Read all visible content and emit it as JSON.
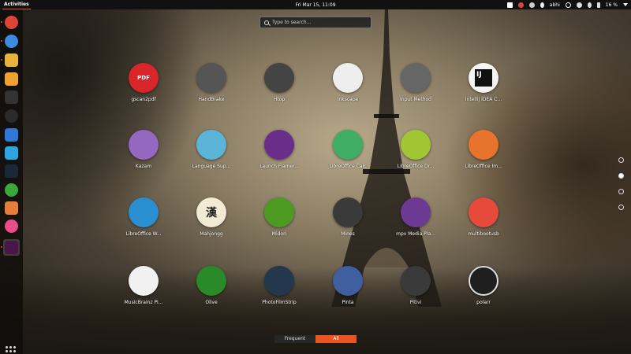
{
  "topbar": {
    "activities": "Activities",
    "clock": "Fri Mar 15, 11:09",
    "user": "abhi",
    "battery": "16 %"
  },
  "search": {
    "placeholder": "Type to search..."
  },
  "dock": {
    "items": [
      {
        "name": "chrome",
        "glyph": "",
        "color": "#db4437"
      },
      {
        "name": "firefox",
        "glyph": "",
        "color": "#3d8be0"
      },
      {
        "name": "files",
        "glyph": "",
        "color": "#e8b23a"
      },
      {
        "name": "ubuntu-software",
        "glyph": "",
        "color": "#f0a030"
      },
      {
        "name": "terminal",
        "glyph": "",
        "color": "#333333"
      },
      {
        "name": "obs",
        "glyph": "",
        "color": "#2b2b2b"
      },
      {
        "name": "virtualbox",
        "glyph": "",
        "color": "#2f78d6"
      },
      {
        "name": "telegram",
        "glyph": "",
        "color": "#2ca5e0"
      },
      {
        "name": "steam",
        "glyph": "",
        "color": "#1b2838"
      },
      {
        "name": "update",
        "glyph": "",
        "color": "#3aa83a"
      },
      {
        "name": "calculator",
        "glyph": "",
        "color": "#e67d3a"
      },
      {
        "name": "headset",
        "glyph": "",
        "color": "#e84c8a"
      },
      {
        "name": "slack",
        "glyph": "",
        "color": "#4a154b"
      }
    ]
  },
  "apps": [
    {
      "label": "gscan2pdf",
      "glyph": "PDF",
      "color": "#d9262a"
    },
    {
      "label": "HandBrake",
      "glyph": "",
      "color": "#555555"
    },
    {
      "label": "Htop",
      "glyph": "",
      "color": "#444444"
    },
    {
      "label": "Inkscape",
      "glyph": "",
      "color": "#eeeeee"
    },
    {
      "label": "Input Method",
      "glyph": "",
      "color": "#666666"
    },
    {
      "label": "IntelliJ IDEA C...",
      "glyph": "IJ",
      "color": "#f4f4f4"
    },
    {
      "label": "Kazam",
      "glyph": "",
      "color": "#9467c0"
    },
    {
      "label": "Language Sup...",
      "glyph": "",
      "color": "#5ab5d9"
    },
    {
      "label": "Launch Flamer...",
      "glyph": "",
      "color": "#6a2d8a"
    },
    {
      "label": "LibreOffice Calc",
      "glyph": "",
      "color": "#3fae64"
    },
    {
      "label": "LibreOffice Dr...",
      "glyph": "",
      "color": "#a0c633"
    },
    {
      "label": "LibreOffice Im...",
      "glyph": "",
      "color": "#e8732c"
    },
    {
      "label": "LibreOffice W...",
      "glyph": "",
      "color": "#2a8fd1"
    },
    {
      "label": "Mahjongg",
      "glyph": "漢",
      "color": "#f2ead3"
    },
    {
      "label": "Midori",
      "glyph": "",
      "color": "#4c9a22"
    },
    {
      "label": "Mines",
      "glyph": "",
      "color": "#3a3a3a"
    },
    {
      "label": "mpv Media Pla...",
      "glyph": "",
      "color": "#6c3a93"
    },
    {
      "label": "multibootusb",
      "glyph": "",
      "color": "#e64a3b"
    },
    {
      "label": "MusicBrainz Pi...",
      "glyph": "",
      "color": "#f1f1f1"
    },
    {
      "label": "Olive",
      "glyph": "",
      "color": "#2a8a2a"
    },
    {
      "label": "PhotoFilmStrip",
      "glyph": "",
      "color": "#23384d"
    },
    {
      "label": "Pinta",
      "glyph": "",
      "color": "#3f5fa0"
    },
    {
      "label": "Pitivi",
      "glyph": "",
      "color": "#3a3a3a"
    },
    {
      "label": "polarr",
      "glyph": "",
      "color": "#1f1f1f"
    }
  ],
  "tabs": {
    "frequent": "Frequent",
    "all": "All"
  }
}
